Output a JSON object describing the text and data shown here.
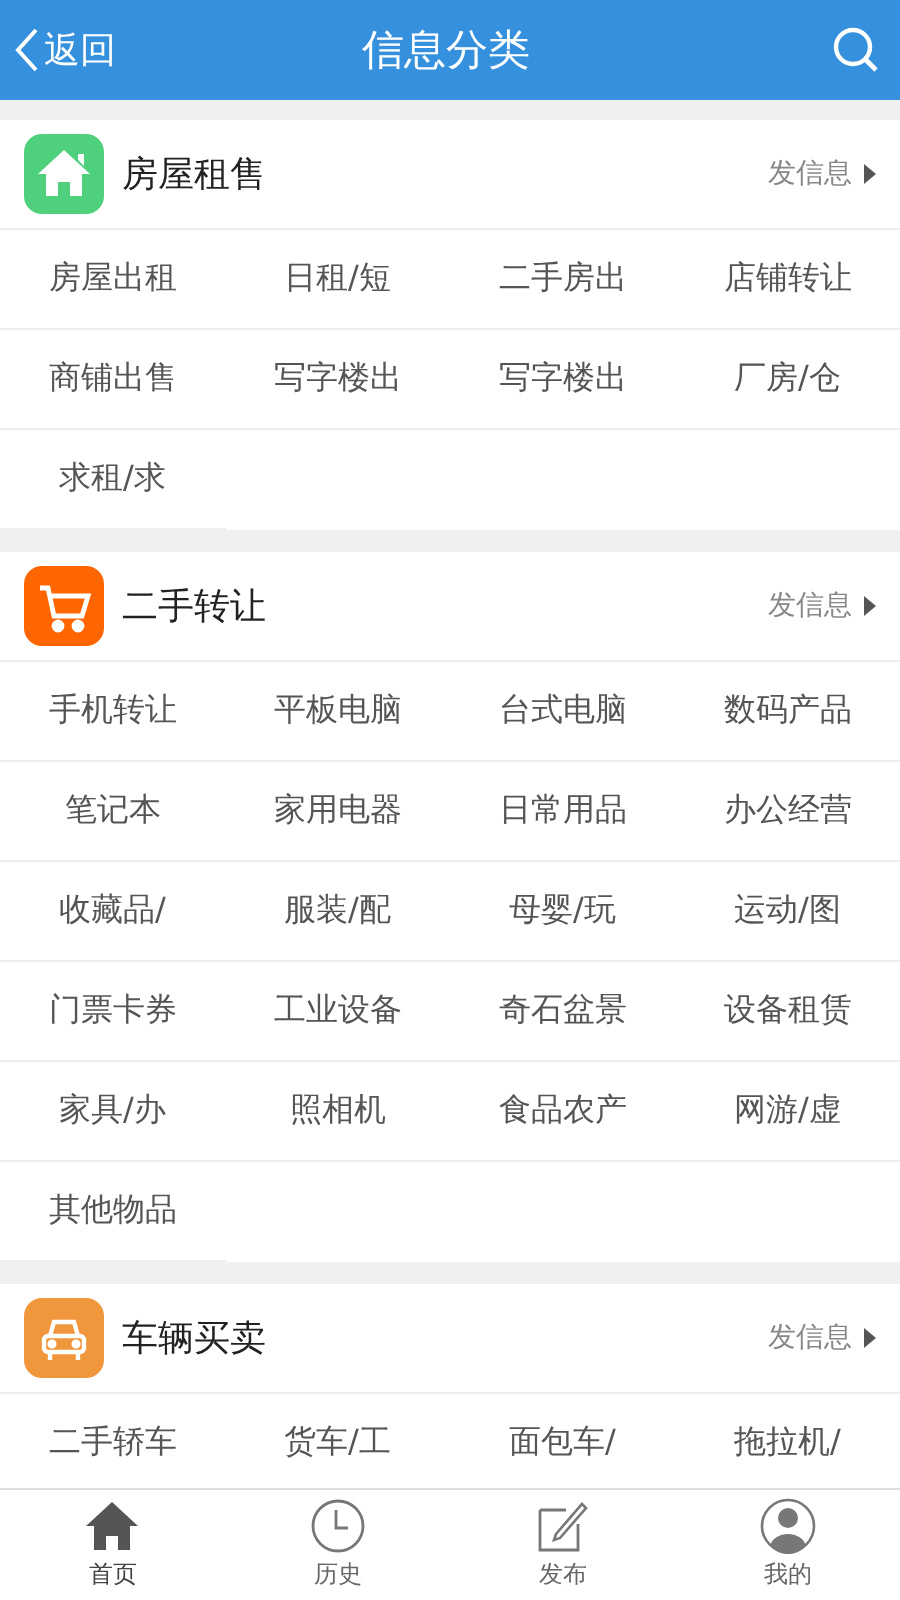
{
  "header": {
    "back": "返回",
    "title": "信息分类"
  },
  "sections": [
    {
      "title": "房屋租售",
      "kind": "house",
      "color": "#4fd07c",
      "action": "发信息",
      "items": [
        "房屋出租",
        "日租/短",
        "二手房出",
        "店铺转让",
        "商铺出售",
        "写字楼出",
        "写字楼出",
        "厂房/仓",
        "求租/求"
      ]
    },
    {
      "title": "二手转让",
      "kind": "cart",
      "color": "#ff6600",
      "action": "发信息",
      "items": [
        "手机转让",
        "平板电脑",
        "台式电脑",
        "数码产品",
        "笔记本",
        "家用电器",
        "日常用品",
        "办公经营",
        "收藏品/",
        "服装/配",
        "母婴/玩",
        "运动/图",
        "门票卡券",
        "工业设备",
        "奇石盆景",
        "设备租赁",
        "家具/办",
        "照相机",
        "食品农产",
        "网游/虚",
        "其他物品"
      ]
    },
    {
      "title": "车辆买卖",
      "kind": "car",
      "color": "#f0963c",
      "action": "发信息",
      "items": [
        "二手轿车",
        "货车/工",
        "面包车/",
        "拖拉机/"
      ]
    }
  ],
  "tabs": [
    {
      "label": "首页",
      "kind": "home",
      "selected": true
    },
    {
      "label": "历史",
      "kind": "clock",
      "selected": false
    },
    {
      "label": "发布",
      "kind": "edit",
      "selected": false
    },
    {
      "label": "我的",
      "kind": "user",
      "selected": false
    }
  ]
}
